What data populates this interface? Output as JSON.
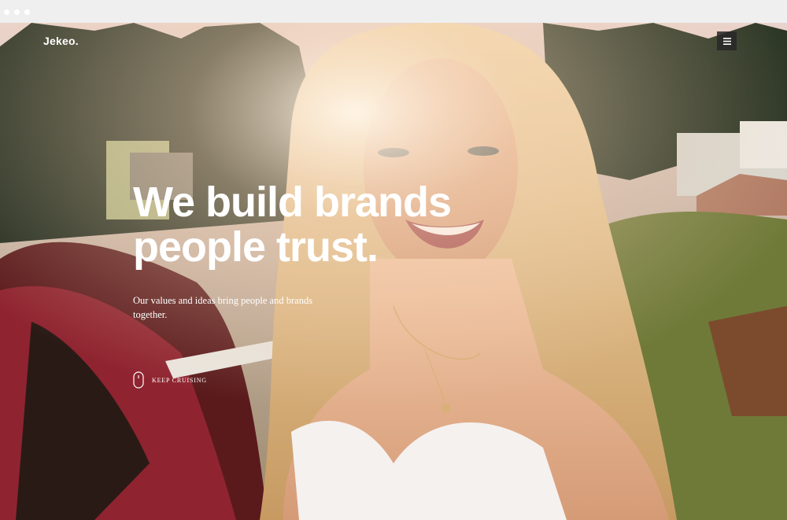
{
  "browser": {
    "window_dots": [
      "dot",
      "dot",
      "dot"
    ]
  },
  "site": {
    "logo": "Jekeo.",
    "menu_icon": "hamburger-menu-icon"
  },
  "hero": {
    "headline": "We build brands people trust.",
    "subheading": "Our values and ideas bring people and brands together.",
    "scroll_label": "KEEP CRUISING",
    "scroll_icon": "mouse-icon"
  },
  "colors": {
    "text": "#ffffff",
    "menu_button_bg": "#282828",
    "chrome": "#efefef"
  }
}
